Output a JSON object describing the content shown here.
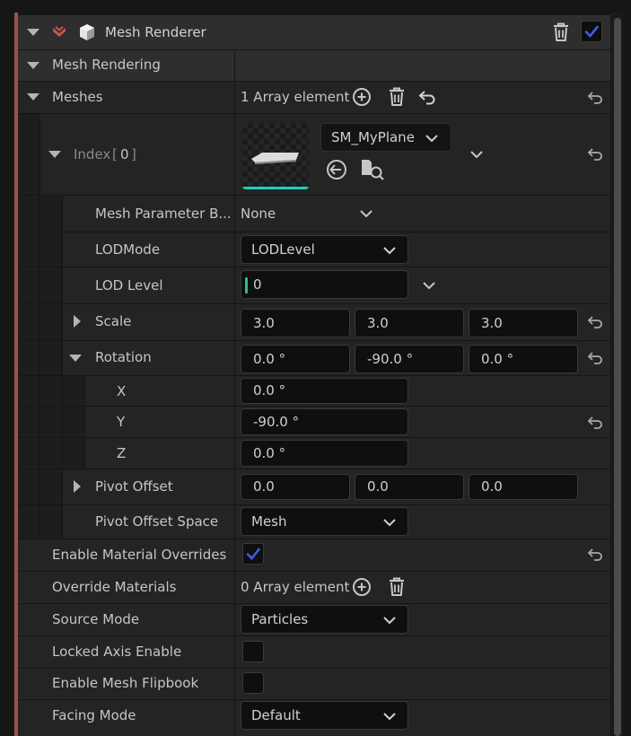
{
  "colors": {
    "accent": "#9e5050",
    "checkbox_checked": "#3f5fe6",
    "thumbnail_underline": "#1ad0c4",
    "input_cursor": "#20c0a8"
  },
  "header": {
    "title": "Mesh Renderer",
    "icons": [
      "chevron-down-icon",
      "emitter-logo-icon",
      "cube-icon",
      "trash-icon",
      "checkbox-icon"
    ],
    "enabled": true
  },
  "mesh_rendering": {
    "label": "Mesh Rendering"
  },
  "meshes": {
    "label": "Meshes",
    "count_text": "1 Array element",
    "icons": [
      "add-circle-icon",
      "trash-icon",
      "undo-arrow-icon",
      "reset-arrow-icon"
    ]
  },
  "index": {
    "label": "Index",
    "bracket_open": "[",
    "number": "0",
    "bracket_close": "]",
    "mesh_asset": "SM_MyPlane",
    "icons": [
      "mesh-thumbnail",
      "browse-back-icon",
      "find-in-browser-icon",
      "chevron-down-icon",
      "reset-arrow-icon"
    ]
  },
  "mesh_parameter_binding": {
    "label": "Mesh Parameter B...",
    "value": "None"
  },
  "lod_mode": {
    "label": "LODMode",
    "value": "LODLevel"
  },
  "lod_level": {
    "label": "LOD Level",
    "value": "0"
  },
  "scale": {
    "label": "Scale",
    "x": "3.0",
    "y": "3.0",
    "z": "3.0"
  },
  "rotation": {
    "label": "Rotation",
    "x": "0.0 °",
    "y": "-90.0 °",
    "z": "0.0 °",
    "x_label": "X",
    "y_label": "Y",
    "z_label": "Z"
  },
  "pivot_offset": {
    "label": "Pivot Offset",
    "x": "0.0",
    "y": "0.0",
    "z": "0.0"
  },
  "pivot_offset_space": {
    "label": "Pivot Offset Space",
    "value": "Mesh"
  },
  "enable_material_overrides": {
    "label": "Enable Material Overrides",
    "checked": true
  },
  "override_materials": {
    "label": "Override Materials",
    "count_text": "0 Array element",
    "icons": [
      "add-circle-icon",
      "trash-icon"
    ]
  },
  "source_mode": {
    "label": "Source Mode",
    "value": "Particles"
  },
  "locked_axis_enable": {
    "label": "Locked Axis Enable",
    "checked": false
  },
  "enable_mesh_flipbook": {
    "label": "Enable Mesh Flipbook",
    "checked": false
  },
  "facing_mode": {
    "label": "Facing Mode",
    "value": "Default"
  }
}
